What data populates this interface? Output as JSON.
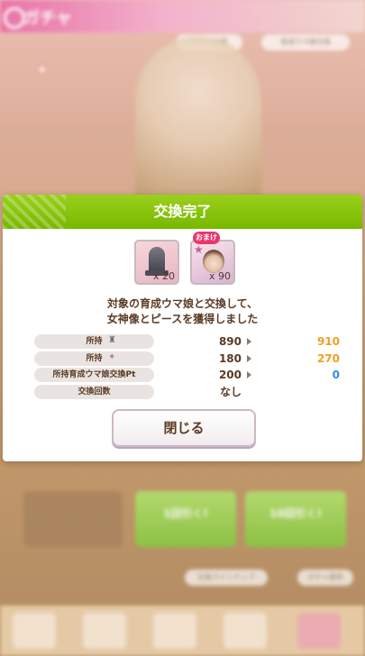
{
  "background": {
    "screen_title": "ガチャ",
    "pills": [
      "ガチャ詳細",
      "育成ウマ娘交換",
      "1回引く!",
      "10回引く!",
      "交換ラインナップ",
      "ガチャ更新"
    ]
  },
  "dialog": {
    "title": "交換完了",
    "items": [
      {
        "icon": "goddess-statue-icon",
        "quantity": "x 20"
      },
      {
        "icon": "character-piece-icon",
        "quantity": "x 90",
        "badge": "おまけ"
      }
    ],
    "message_line1": "対象の育成ウマ娘と交換して、",
    "message_line2": "女神像とピースを獲得しました",
    "rows": [
      {
        "label": "所持",
        "icon": "goddess-statue-icon",
        "before": "890",
        "after": "910",
        "after_color": "#f0a020"
      },
      {
        "label": "所持",
        "icon": "character-piece-icon",
        "before": "180",
        "after": "270",
        "after_color": "#f0a020"
      },
      {
        "label": "所持育成ウマ娘交換Pt",
        "before": "200",
        "after": "0",
        "after_color": "#2e8ede"
      },
      {
        "label": "交換回数",
        "before": "なし",
        "after": ""
      }
    ],
    "close_label": "閉じる"
  }
}
